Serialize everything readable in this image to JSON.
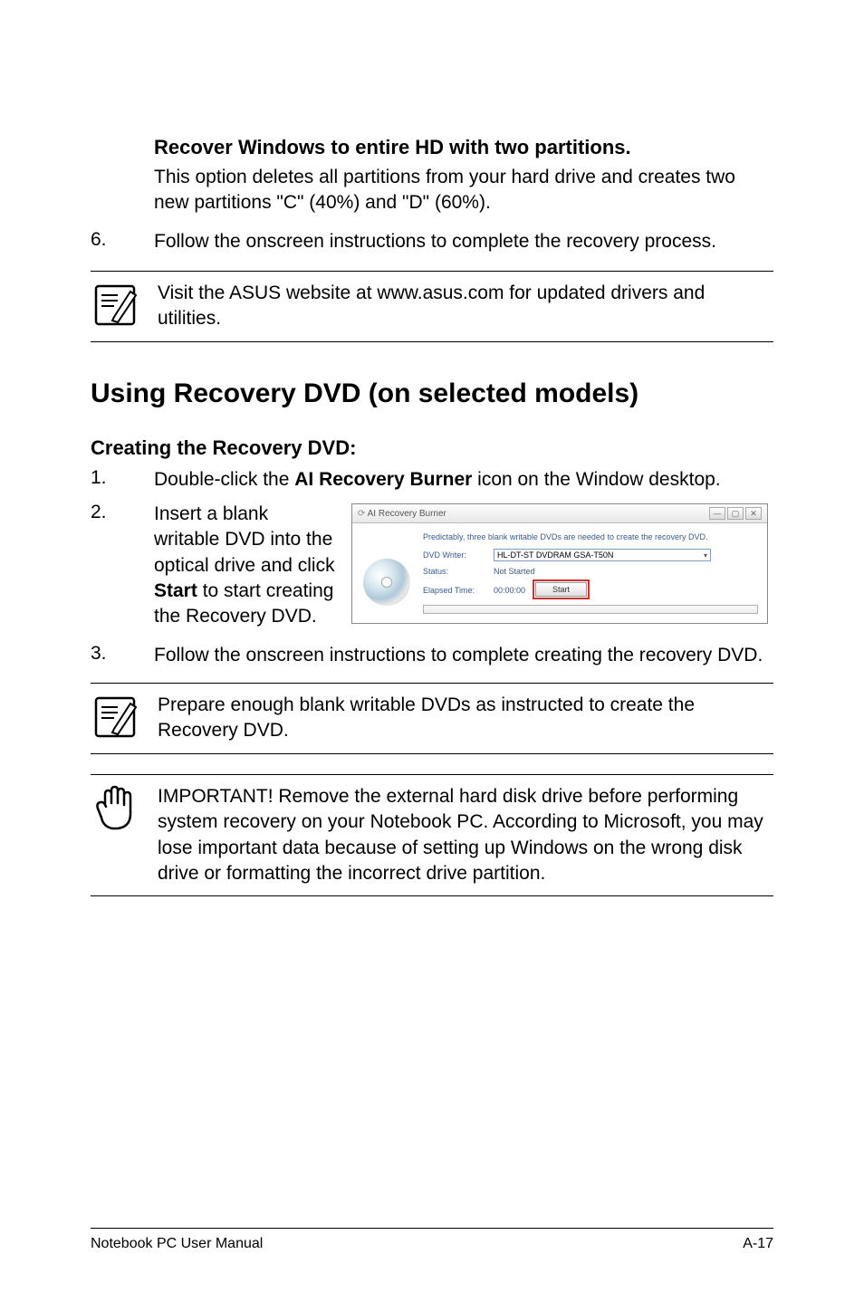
{
  "para1_title": "Recover Windows to entire HD with two partitions.",
  "para1_body": "This option deletes all partitions from your hard drive and creates two new partitions \"C\" (40%) and \"D\" (60%).",
  "step6_num": "6.",
  "step6_body": "Follow the onscreen instructions to complete the recovery process.",
  "note1": "Visit the ASUS website at www.asus.com for updated drivers and utilities.",
  "section_heading": "Using Recovery DVD (on selected models)",
  "sub_heading": "Creating the Recovery DVD:",
  "step1_num": "1.",
  "step1_pre": "Double-click the ",
  "step1_bold": "AI Recovery Burner",
  "step1_post": " icon on the Window desktop.",
  "step2_num": "2.",
  "step2_pre": "Insert a blank writable DVD into the optical drive and click ",
  "step2_bold": "Start",
  "step2_post": " to start creating the Recovery DVD.",
  "step3_num": "3.",
  "step3_body": "Follow the onscreen instructions to complete creating the recovery DVD.",
  "note2": "Prepare enough blank writable DVDs as instructed to create the Recovery DVD.",
  "note3": "IMPORTANT! Remove the external hard disk drive before performing system recovery on your Notebook PC. According to Microsoft, you may lose important data because of setting up Windows on the wrong disk drive or formatting the incorrect drive partition.",
  "footer_left": "Notebook PC User Manual",
  "footer_right": "A-17",
  "app": {
    "title": "AI Recovery Burner",
    "message": "Predictably, three blank writable DVDs are needed to create the recovery DVD.",
    "writer_label": "DVD Writer:",
    "writer_value": "HL-DT-ST DVDRAM GSA-T50N",
    "status_label": "Status:",
    "status_value": "Not Started",
    "elapsed_label": "Elapsed Time:",
    "elapsed_value": "00:00:00",
    "start_button": "Start"
  }
}
